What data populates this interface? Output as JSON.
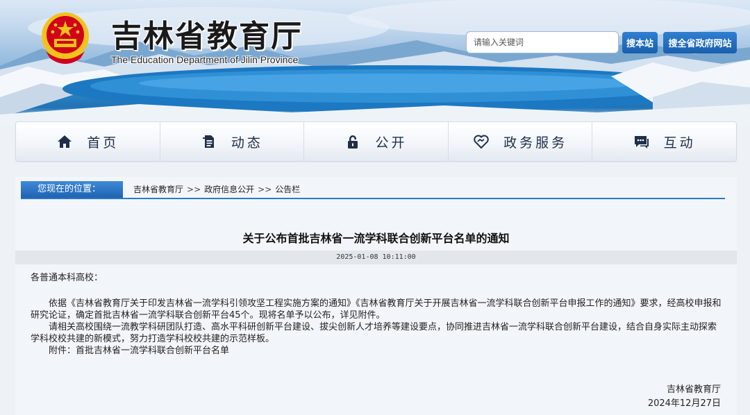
{
  "header": {
    "title": "吉林省教育厅",
    "subtitle": "The Education Department of Jilin Province",
    "emblem": "national-emblem-icon"
  },
  "search": {
    "placeholder": "请输入关键词",
    "site_button": "搜本站",
    "gov_button": "搜全省政府网站"
  },
  "nav": {
    "items": [
      {
        "label": "首页",
        "icon": "home-icon"
      },
      {
        "label": "动态",
        "icon": "document-icon"
      },
      {
        "label": "公开",
        "icon": "lock-icon"
      },
      {
        "label": "政务服务",
        "icon": "heart-handshake-icon"
      },
      {
        "label": "互动",
        "icon": "chat-icon"
      }
    ]
  },
  "breadcrumb": {
    "label": "您现在的位置：",
    "items": [
      "吉林省教育厅",
      "政府信息公开",
      "公告栏"
    ],
    "separator": ">>"
  },
  "article": {
    "title": "关于公布首批吉林省一流学科联合创新平台名单的通知",
    "datetime": "2025-01-08 10:11:00",
    "greeting": "各普通本科高校：",
    "paragraphs": [
      "依据《吉林省教育厅关于印发吉林省一流学科引领攻坚工程实施方案的通知》《吉林省教育厅关于开展吉林省一流学科联合创新平台申报工作的通知》要求，经高校申报和研究论证，确定首批吉林省一流学科联合创新平台45个。现将名单予以公布，详见附件。",
      "请相关高校围绕一流教学科研团队打造、高水平科研创新平台建设、拔尖创新人才培养等建设要点，协同推进吉林省一流学科联合创新平台建设，结合自身实际主动探索学科校校共建的新模式，努力打造学科校校共建的示范样板。",
      "附件：首批吉林省一流学科联合创新平台名单"
    ],
    "signature_org": "吉林省教育厅",
    "signature_date": "2024年12月27日"
  },
  "colors": {
    "accent": "#1f63b3",
    "nav_text": "#1e2f4a",
    "emblem_red": "#d0021b",
    "emblem_gold": "#f4c21b"
  }
}
